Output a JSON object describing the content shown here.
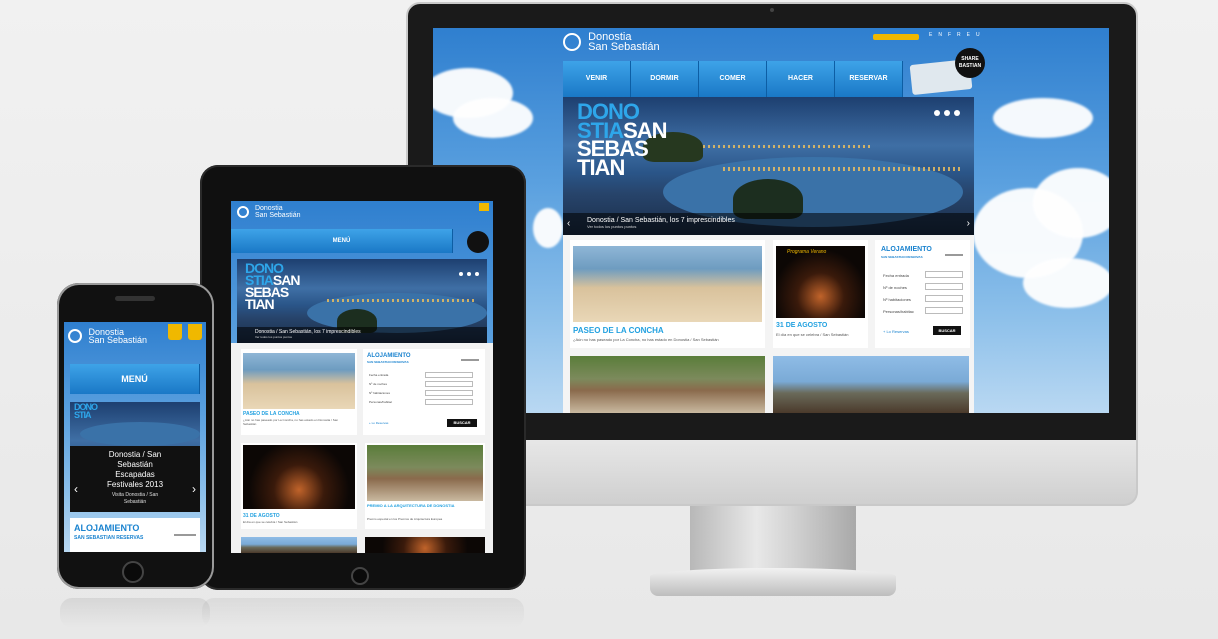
{
  "monitor": {
    "top_pills": [
      "EN",
      "FR",
      "EU"
    ],
    "nav": [
      "VENIR",
      "DORMIR",
      "COMER",
      "HACER",
      "RESERVAR"
    ],
    "logo": {
      "line1": "Donostia",
      "line2": "San Sebastián"
    },
    "hero": {
      "title_blue": [
        "DONO",
        "STIA"
      ],
      "title_white": [
        "SAN",
        "SEBAS",
        "TIAN"
      ],
      "caption": "Donostia / San Sebastián, los 7 imprescindibles",
      "caption_sub": "Ver todos los puntos puntos"
    },
    "cards": [
      {
        "title": "PASEO DE LA CONCHA",
        "text": "¿Aún no has paseado por La Concha, no has estado en Donostia / San Sebastián"
      },
      {
        "title": "31 DE AGOSTO",
        "text": "El día en que se celebra / San Sebastián",
        "top_label": "Programa Verano"
      }
    ],
    "aloj": {
      "title": "ALOJAMIENTO",
      "sub": "SAN SEBASTIAN RESERVAS",
      "fields": [
        "Fecha entrada",
        "Nº de noches",
        "Nº habitaciones",
        "Personas/habitac"
      ],
      "link": "+ Lo Reservas",
      "button": "BUSCAR"
    },
    "badge": "SHARE BASTIAN"
  },
  "tablet": {
    "menu": "MENÚ",
    "logo": {
      "line1": "Donostia",
      "line2": "San Sebastián"
    },
    "hero": {
      "title_blue": [
        "DONO",
        "STIA"
      ],
      "title_white": [
        "SAN",
        "SEBAS",
        "TIAN"
      ],
      "caption": "Donostia / San Sebastián, los 7 imprescindibles",
      "caption_sub": "Ver todos los puntos puntos"
    },
    "cards": [
      {
        "title": "PASEO DE LA CONCHA",
        "text": "¿Aún no has paseado por La Concha, no has estado en Donostia / San Sebastián"
      },
      {
        "title": "31 DE AGOSTO",
        "text": "El día en que se celebra / San Sebastián"
      },
      {
        "title": "PREMIO A LA ARQUITECTURA DE DONOSTIA",
        "text": "Premio especial en los Premios de Arquitectura Europea"
      }
    ],
    "aloj": {
      "title": "ALOJAMIENTO",
      "sub": "SAN SEBASTIAN RESERVAS",
      "fields": [
        "Fecha entrada",
        "Nº de noches",
        "Nº habitaciones",
        "Personas/habitac"
      ],
      "link": "+ Lo Reservas",
      "button": "BUSCAR"
    }
  },
  "phone": {
    "menu": "MENÚ",
    "logo": {
      "line1": "Donostia",
      "line2": "San Sebastián"
    },
    "slide_title_blue": [
      "DONO",
      "STIA"
    ],
    "caption": [
      "Donostia / San",
      "Sebastián",
      "Escapadas",
      "Festivales 2013"
    ],
    "caption_sub": [
      "Visita Donostia / San",
      "Sebastián"
    ],
    "aloj_title": "ALOJAMIENTO",
    "aloj_sub": "SAN SEBASTIAN RESERVAS"
  },
  "colors": {
    "accent": "#22a1e0",
    "nav": "#1a78c6",
    "badge": "#f0b800"
  }
}
